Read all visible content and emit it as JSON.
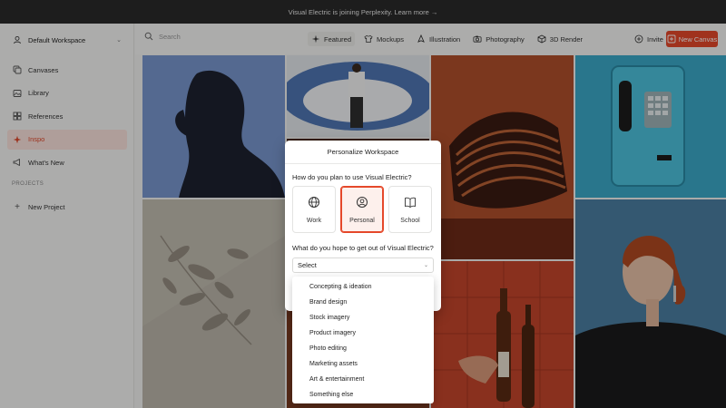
{
  "banner": {
    "text": "Visual Electric is joining Perplexity. Learn more →"
  },
  "sidebar": {
    "workspace": "Default Workspace",
    "items": [
      {
        "label": "Canvases",
        "icon": "canvases-icon",
        "active": false
      },
      {
        "label": "Library",
        "icon": "library-icon",
        "active": false
      },
      {
        "label": "References",
        "icon": "references-icon",
        "active": false
      },
      {
        "label": "Inspo",
        "icon": "inspo-icon",
        "active": true
      },
      {
        "label": "What's New",
        "icon": "megaphone-icon",
        "active": false
      }
    ],
    "projects_label": "PROJECTS",
    "new_project": "New Project"
  },
  "topbar": {
    "search_placeholder": "Search",
    "tabs": [
      {
        "label": "Featured",
        "active": true
      },
      {
        "label": "Mockups",
        "active": false
      },
      {
        "label": "Illustration",
        "active": false
      },
      {
        "label": "Photography",
        "active": false
      },
      {
        "label": "3D Render",
        "active": false
      }
    ],
    "invite": "Invite",
    "new_canvas": "New Canvas"
  },
  "modal": {
    "title": "Personalize Workspace",
    "question1": "How do you plan to use Visual Electric?",
    "options": [
      {
        "label": "Work",
        "icon": "globe-icon",
        "selected": false
      },
      {
        "label": "Personal",
        "icon": "person-icon",
        "selected": true
      },
      {
        "label": "School",
        "icon": "book-icon",
        "selected": false
      }
    ],
    "question2": "What do you hope to get out of Visual Electric?",
    "select_value": "Select"
  },
  "dropdown": {
    "options": [
      "Concepting & ideation",
      "Brand design",
      "Stock imagery",
      "Product imagery",
      "Photo editing",
      "Marketing assets",
      "Art & entertainment",
      "Something else"
    ]
  },
  "colors": {
    "accent": "#e5482a",
    "active_bg": "#fbe3dd",
    "banner_bg": "#2a2a2a"
  }
}
